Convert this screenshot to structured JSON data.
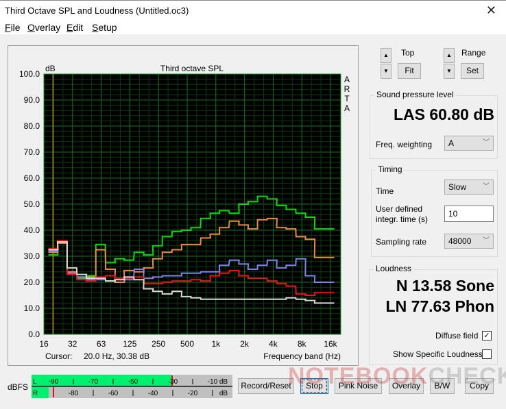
{
  "window": {
    "title": "Third Octave SPL and Loudness (Untitled.oc3)",
    "close_icon": "close-icon"
  },
  "menu": [
    {
      "label": "File",
      "accel": "F",
      "rest": "ile"
    },
    {
      "label": "Overlay",
      "accel": "O",
      "rest": "verlay"
    },
    {
      "label": "Edit",
      "accel": "E",
      "rest": "dit"
    },
    {
      "label": "Setup",
      "accel": "S",
      "rest": "etup"
    }
  ],
  "controls": {
    "top_label": "Top",
    "fit_label": "Fit",
    "range_label": "Range",
    "set_label": "Set",
    "up_icon": "▲",
    "down_icon": "▼"
  },
  "spl": {
    "group_label": "Sound pressure level",
    "value": "LAS 60.80 dB",
    "weighting_label": "Freq. weighting",
    "weighting_value": "A"
  },
  "timing": {
    "group_label": "Timing",
    "time_label": "Time",
    "time_value": "Slow",
    "integr_label_1": "User defined",
    "integr_label_2": "integr. time (s)",
    "integr_value": "10",
    "sampling_label": "Sampling rate",
    "sampling_value": "48000"
  },
  "loudness": {
    "group_label": "Loudness",
    "n_value": "N 13.58 Sone",
    "ln_value": "LN 77.63 Phon",
    "diffuse_label": "Diffuse field",
    "diffuse_checked": true,
    "specific_label": "Show Specific Loudness",
    "specific_checked": false
  },
  "meter": {
    "label": "dBFS",
    "left_channel": "L",
    "right_channel": "R",
    "left_ticks": [
      "-90",
      "-70",
      "-50",
      "-30",
      "-10"
    ],
    "right_ticks": [
      "-80",
      "-60",
      "-40",
      "-20"
    ],
    "unit": "dB",
    "left_level_dbfs": -26,
    "right_level_dbfs": -94,
    "range_dbfs": [
      -100,
      0
    ]
  },
  "buttons": {
    "record_reset": "Record/Reset",
    "stop": "Stop",
    "pink_noise": "Pink Noise",
    "overlay": "Overlay",
    "bw": "B/W",
    "copy": "Copy"
  },
  "watermark": {
    "text_a": "NOTEBOOK",
    "text_b": "CHECK"
  },
  "chart_data": {
    "type": "line",
    "step": true,
    "title": "Third octave SPL",
    "ylabel": "dB",
    "xlabel": "Frequency band (Hz)",
    "side_label": "ARTA",
    "ylim": [
      0,
      100
    ],
    "yticks": [
      "0.0",
      "10.0",
      "20.0",
      "30.0",
      "40.0",
      "50.0",
      "60.0",
      "70.0",
      "80.0",
      "90.0",
      "100.0"
    ],
    "xticks": [
      "16",
      "32",
      "63",
      "125",
      "250",
      "500",
      "1k",
      "2k",
      "4k",
      "8k",
      "16k"
    ],
    "x_bands_hz": [
      20,
      25,
      31.5,
      40,
      50,
      63,
      80,
      100,
      125,
      160,
      200,
      250,
      315,
      400,
      500,
      630,
      800,
      1000,
      1250,
      1600,
      2000,
      2500,
      3150,
      4000,
      5000,
      6300,
      8000,
      10000,
      12500,
      16000
    ],
    "cursor_text": "Cursor:     20.0 Hz, 30.38 dB",
    "cursor_hz": 20,
    "grid": true,
    "colors": {
      "background": "#000000",
      "grid": "#0a7a1a",
      "grid_minor": "#053d0d",
      "cursor": "#8a7a10"
    },
    "series": [
      {
        "name": "green",
        "color": "#00e000",
        "values": [
          30.5,
          35.3,
          23.5,
          21.5,
          22.5,
          34.5,
          27.5,
          29.0,
          28.5,
          31.5,
          30.5,
          34.0,
          37.5,
          39.5,
          40.0,
          41.0,
          44.5,
          46.5,
          47.5,
          46.5,
          50.0,
          51.0,
          53.0,
          52.0,
          49.5,
          48.0,
          46.5,
          45.0,
          40.5,
          40.5
        ]
      },
      {
        "name": "orange",
        "color": "#f08840",
        "values": [
          31.5,
          35.0,
          24.0,
          22.0,
          22.0,
          32.5,
          25.0,
          20.0,
          24.5,
          24.0,
          25.5,
          29.0,
          31.5,
          32.5,
          34.5,
          34.5,
          37.0,
          38.5,
          41.0,
          43.5,
          42.0,
          40.5,
          44.0,
          44.5,
          41.0,
          40.5,
          37.5,
          36.5,
          29.5,
          29.5
        ]
      },
      {
        "name": "blue",
        "color": "#8080f0",
        "values": [
          32.0,
          35.5,
          23.5,
          22.0,
          21.0,
          21.0,
          20.5,
          21.5,
          21.0,
          25.0,
          21.5,
          22.0,
          22.5,
          22.5,
          23.5,
          23.5,
          24.0,
          24.0,
          26.5,
          28.5,
          27.0,
          25.0,
          26.5,
          28.5,
          25.5,
          26.5,
          29.0,
          22.5,
          20.0,
          20.0
        ]
      },
      {
        "name": "red",
        "color": "#f01010",
        "values": [
          33.0,
          36.0,
          23.0,
          21.0,
          20.5,
          22.0,
          22.5,
          21.5,
          21.5,
          22.0,
          19.5,
          19.5,
          20.0,
          20.5,
          20.5,
          21.0,
          20.5,
          22.5,
          23.5,
          24.5,
          22.5,
          21.5,
          21.5,
          20.5,
          19.5,
          18.5,
          15.5,
          15.0,
          16.0,
          16.0
        ]
      },
      {
        "name": "white",
        "color": "#d8d8d8",
        "values": [
          32.5,
          35.5,
          25.5,
          23.0,
          21.5,
          21.5,
          20.5,
          21.0,
          22.0,
          21.0,
          17.5,
          16.5,
          15.5,
          16.5,
          14.5,
          14.0,
          13.5,
          13.5,
          13.5,
          13.5,
          13.5,
          13.5,
          13.5,
          13.5,
          13.5,
          14.0,
          13.5,
          13.0,
          12.0,
          12.0
        ]
      }
    ]
  }
}
